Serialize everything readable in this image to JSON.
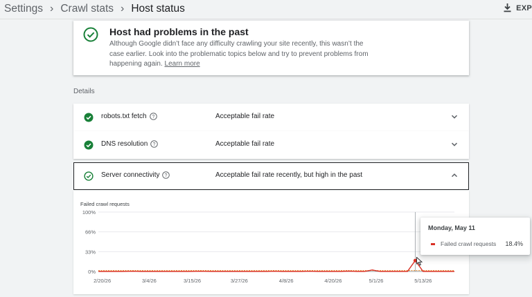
{
  "breadcrumbs": [
    {
      "label": "Settings"
    },
    {
      "label": "Crawl stats"
    },
    {
      "label": "Host status"
    }
  ],
  "toolbar": {
    "export_label": "EXP"
  },
  "summary": {
    "title": "Host had problems in the past",
    "description": "Although Google didn’t face any difficulty crawling your site recently, this wasn’t the case earlier. Look into the problematic topics below and try to prevent problems from happening again.",
    "learn_more": "Learn more"
  },
  "details_label": "Details",
  "rows": [
    {
      "label": "robots.txt fetch",
      "status": "Acceptable fail rate"
    },
    {
      "label": "DNS resolution",
      "status": "Acceptable fail rate"
    },
    {
      "label": "Server connectivity",
      "status": "Acceptable fail rate recently, but high in the past"
    }
  ],
  "colors": {
    "success": "#188038",
    "series": "#d93025",
    "threshold": "#e37400"
  },
  "chart_data": {
    "type": "line",
    "title": "Failed crawl requests",
    "y_ticks": [
      "100%",
      "66%",
      "33%",
      "0%"
    ],
    "ylim": [
      0,
      100
    ],
    "x_ticks": [
      "2/20/26",
      "3/4/26",
      "3/15/26",
      "3/27/26",
      "4/8/26",
      "4/20/26",
      "5/1/26",
      "5/13/26"
    ],
    "x_start": "2026-02-19",
    "x_end": "2026-05-21",
    "threshold": 1.5,
    "grid": true,
    "series": [
      {
        "name": "Failed crawl requests",
        "points": [
          [
            "2026-02-19",
            0
          ],
          [
            "2026-02-25",
            0
          ],
          [
            "2026-02-28",
            0.3
          ],
          [
            "2026-03-02",
            0
          ],
          [
            "2026-03-14",
            0
          ],
          [
            "2026-03-17",
            0.3
          ],
          [
            "2026-03-20",
            0
          ],
          [
            "2026-04-03",
            0
          ],
          [
            "2026-04-05",
            0.3
          ],
          [
            "2026-04-07",
            0
          ],
          [
            "2026-04-12",
            0
          ],
          [
            "2026-04-14",
            0.3
          ],
          [
            "2026-04-16",
            0
          ],
          [
            "2026-04-22",
            0
          ],
          [
            "2026-04-24",
            0.6
          ],
          [
            "2026-04-26",
            0
          ],
          [
            "2026-04-28",
            0
          ],
          [
            "2026-04-30",
            2.5
          ],
          [
            "2026-05-02",
            0
          ],
          [
            "2026-05-09",
            0
          ],
          [
            "2026-05-11",
            18.4
          ],
          [
            "2026-05-13",
            0
          ],
          [
            "2026-05-21",
            0
          ]
        ]
      }
    ],
    "tooltip": {
      "date": "Monday, May 11",
      "series": "Failed crawl requests",
      "value": "18.4%"
    }
  }
}
